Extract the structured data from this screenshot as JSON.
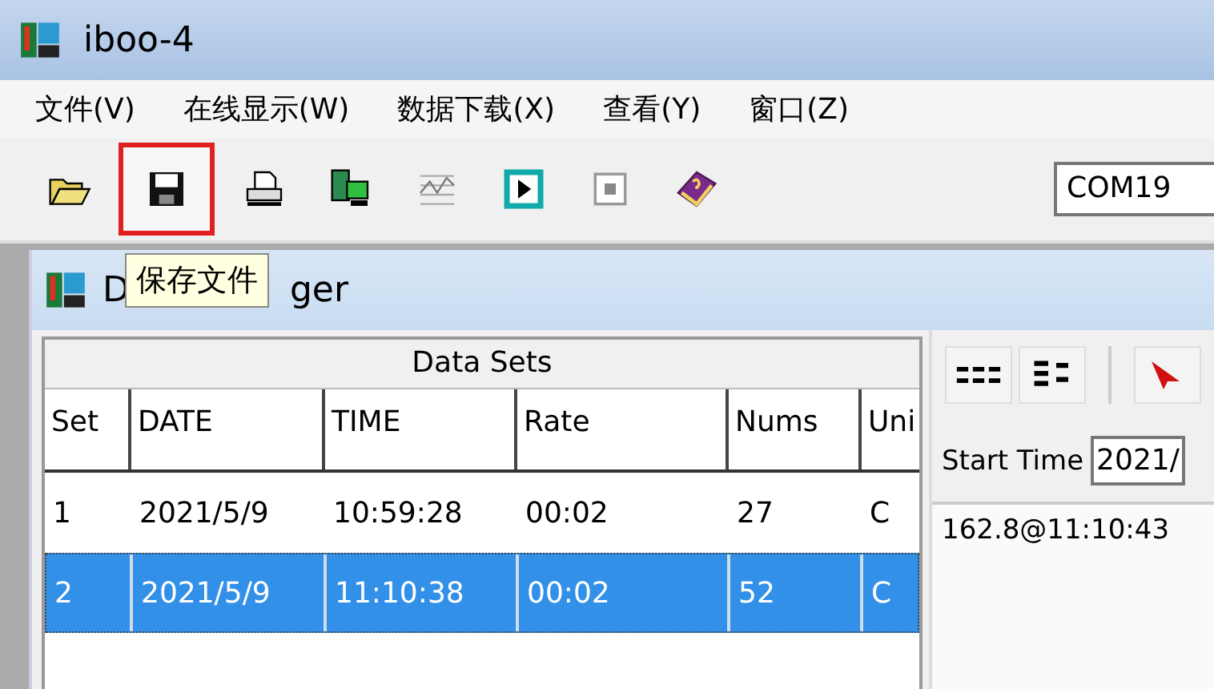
{
  "window": {
    "title": "iboo-4"
  },
  "menu": [
    "文件(V)",
    "在线显示(W)",
    "数据下载(X)",
    "查看(Y)",
    "窗口(Z)"
  ],
  "toolbar": {
    "buttons": [
      {
        "kind": "open",
        "highlighted": false
      },
      {
        "kind": "save",
        "highlighted": true
      },
      {
        "kind": "print",
        "highlighted": false
      },
      {
        "kind": "transfer",
        "highlighted": false
      },
      {
        "kind": "chart",
        "highlighted": false
      },
      {
        "kind": "play",
        "highlighted": false
      },
      {
        "kind": "stop",
        "highlighted": false
      },
      {
        "kind": "help",
        "highlighted": false
      }
    ],
    "port": "COM19"
  },
  "tooltip": "保存文件",
  "child_window": {
    "title_start": "D",
    "title_end": "ger"
  },
  "table": {
    "title": "Data Sets",
    "columns": [
      "Set",
      "DATE",
      "TIME",
      "Rate",
      "Nums",
      "Uni"
    ],
    "rows": [
      {
        "cells": [
          "1",
          "2021/5/9",
          "10:59:28",
          "00:02",
          "27",
          "C"
        ],
        "selected": false
      },
      {
        "cells": [
          "2",
          "2021/5/9",
          "11:10:38",
          "00:02",
          "52",
          "C"
        ],
        "selected": true
      }
    ]
  },
  "side_panel": {
    "start_time_label": "Start Time",
    "start_time_value": "2021/",
    "reading": "162.8@11:10:43"
  }
}
